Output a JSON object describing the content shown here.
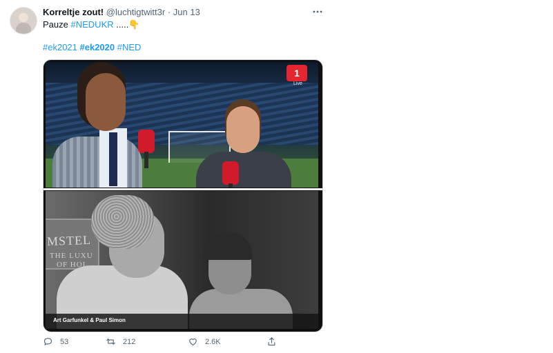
{
  "tweet": {
    "display_name": "Korreltje zout!",
    "handle": "@luchtigtwitt3r",
    "separator": "·",
    "date": "Jun 13",
    "text_prefix": "Pauze",
    "inline_hashtag": "#NEDUKR",
    "text_suffix": ".....",
    "emoji": "👇",
    "hashtags": [
      "#ek2021",
      "#ek2020",
      "#NED"
    ]
  },
  "media": {
    "channel_logo": "1",
    "live_label": "Live",
    "sign_text": "MSTEL",
    "sign_sub1": "THE LUXU",
    "sign_sub2": "OF HOL",
    "caption": "Art Garfunkel & Paul Simon"
  },
  "actions": {
    "replies": "53",
    "retweets": "212",
    "likes": "2.6K"
  },
  "colors": {
    "link": "#1d9bf0",
    "muted": "#536471",
    "text": "#0f1419"
  },
  "icons": [
    "more-icon",
    "reply-icon",
    "retweet-icon",
    "like-icon",
    "share-icon"
  ]
}
